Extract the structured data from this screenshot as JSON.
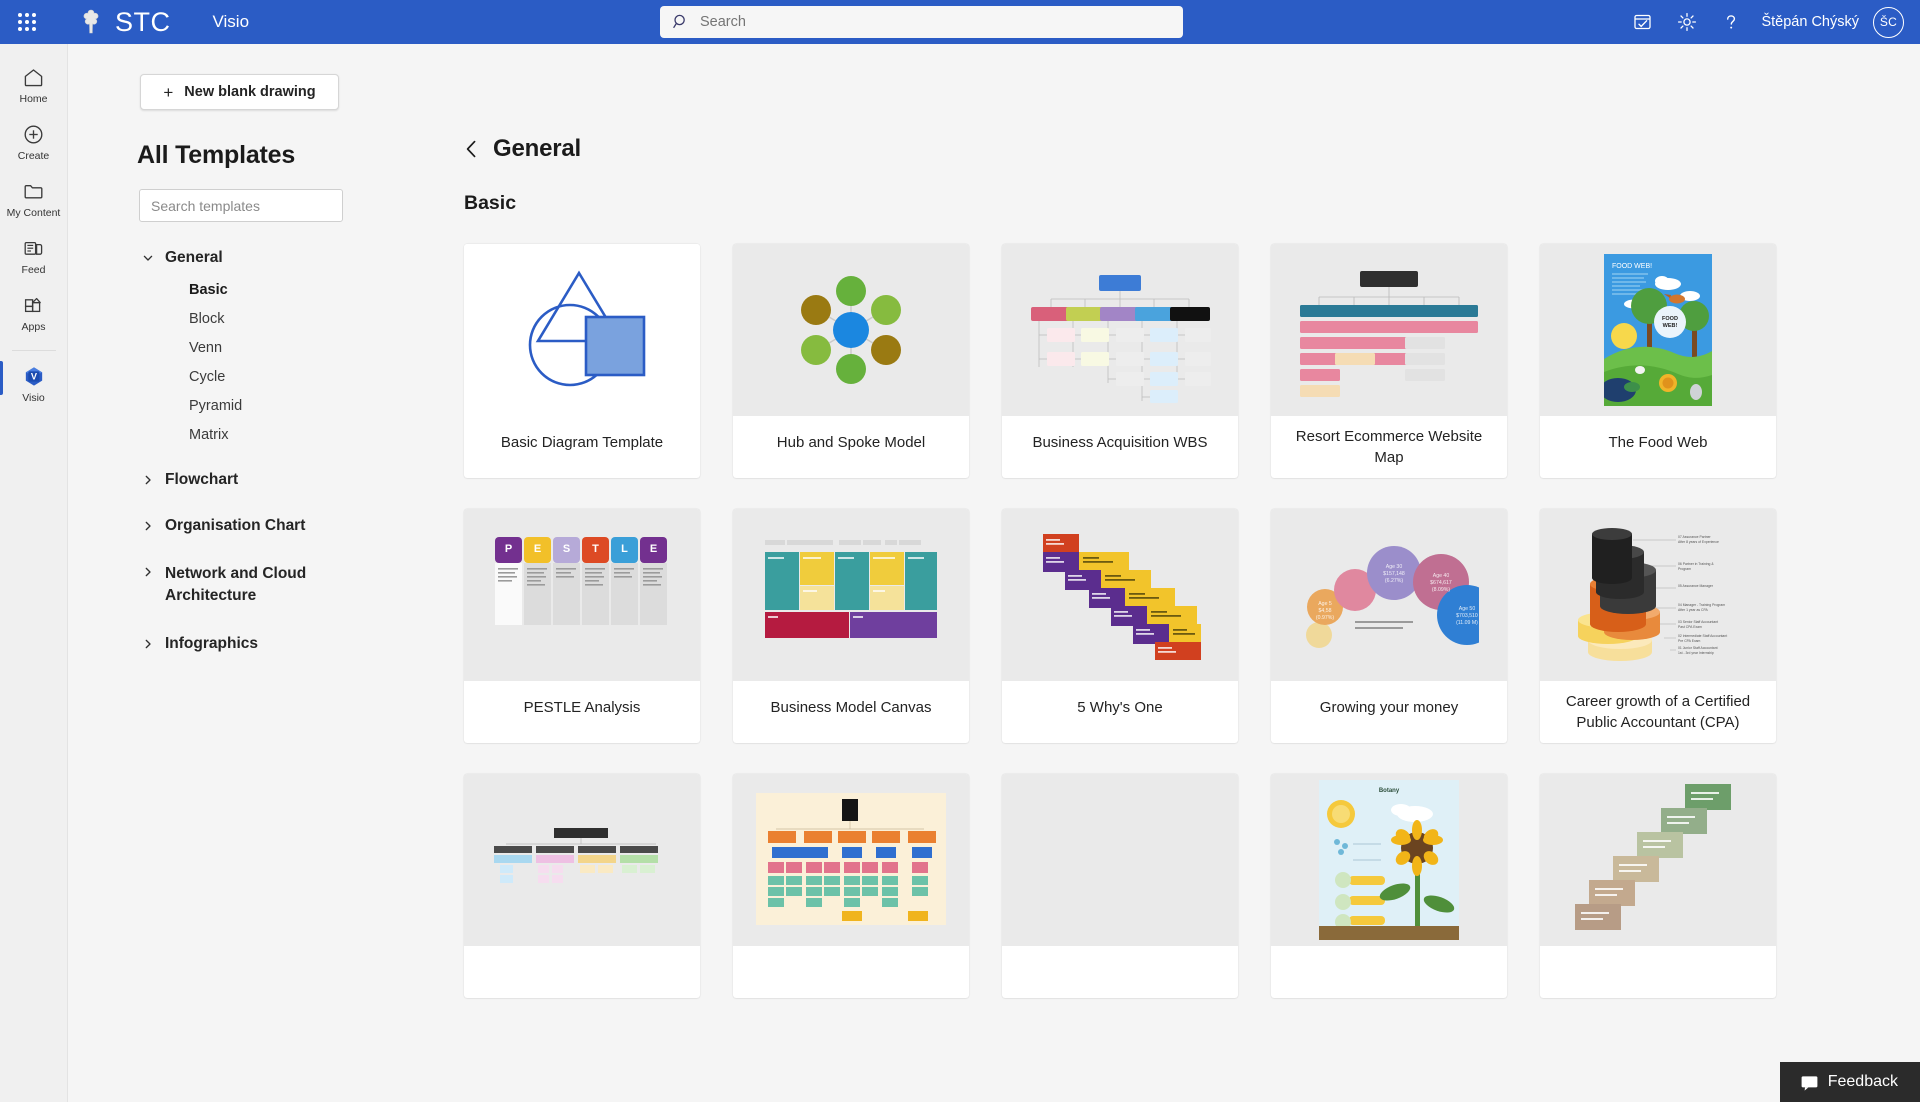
{
  "topbar": {
    "waffle_label": "app-launcher",
    "brand": "STC",
    "app_name": "Visio",
    "search_placeholder": "Search",
    "search_value": "",
    "icons": [
      "tasks-icon",
      "gear-icon",
      "help-icon"
    ],
    "user_name": "Štěpán Chýský",
    "avatar_initials": "ŠC",
    "bg_color": "#2b5cc5"
  },
  "rail": {
    "items": [
      {
        "label": "Home",
        "icon": "home-icon",
        "active": false
      },
      {
        "label": "Create",
        "icon": "plus-circle-icon",
        "active": false
      },
      {
        "label": "My Content",
        "icon": "folder-icon",
        "active": false
      },
      {
        "label": "Feed",
        "icon": "feed-icon",
        "active": false
      },
      {
        "label": "Apps",
        "icon": "apps-icon",
        "active": false
      },
      {
        "label": "Visio",
        "icon": "visio-icon",
        "active": true
      }
    ]
  },
  "leftpanel": {
    "new_blank_drawing": "New blank drawing",
    "heading": "All Templates",
    "search_placeholder": "Search templates",
    "search_value": "",
    "tree": [
      {
        "label": "General",
        "expanded": true,
        "children": [
          "Basic",
          "Block",
          "Venn",
          "Cycle",
          "Pyramid",
          "Matrix"
        ],
        "selected_child": "Basic"
      },
      {
        "label": "Flowchart",
        "expanded": false,
        "children": []
      },
      {
        "label": "Organisation Chart",
        "expanded": false,
        "children": []
      },
      {
        "label": "Network and Cloud Architecture",
        "expanded": false,
        "children": []
      },
      {
        "label": "Infographics",
        "expanded": false,
        "children": []
      }
    ]
  },
  "main": {
    "breadcrumb": "General",
    "section_title": "Basic",
    "cards": [
      {
        "title": "Basic Diagram Template",
        "thumb": "basic-shapes-thumb",
        "white": true
      },
      {
        "title": "Hub and Spoke Model",
        "thumb": "hub-spoke-thumb",
        "white": false
      },
      {
        "title": "Business Acquisition WBS",
        "thumb": "wbs-tree-thumb",
        "white": false
      },
      {
        "title": "Resort Ecommerce Website Map",
        "thumb": "sitemap-thumb",
        "white": false
      },
      {
        "title": "The Food Web",
        "thumb": "food-web-poster-thumb",
        "white": false
      },
      {
        "title": "PESTLE Analysis",
        "thumb": "pestle-columns-thumb",
        "white": false
      },
      {
        "title": "Business Model Canvas",
        "thumb": "bmc-grid-thumb",
        "white": false
      },
      {
        "title": "5 Why's One",
        "thumb": "five-whys-stairs-thumb",
        "white": false
      },
      {
        "title": "Growing your money",
        "thumb": "money-bubbles-thumb",
        "white": false
      },
      {
        "title": "Career growth of a Certified Public Accountant (CPA)",
        "thumb": "cylinders-thumb",
        "white": false
      },
      {
        "title": "",
        "thumb": "org-chart-small-thumb",
        "white": false
      },
      {
        "title": "",
        "thumb": "big-org-chart-thumb",
        "white": false
      },
      {
        "title": "",
        "thumb": "empty-thumb",
        "white": false
      },
      {
        "title": "",
        "thumb": "botany-poster-thumb",
        "white": false
      },
      {
        "title": "",
        "thumb": "green-stairs-thumb",
        "white": false
      }
    ],
    "pestle_letters": [
      "P",
      "E",
      "S",
      "T",
      "L",
      "E"
    ],
    "food_web_title": "FOOD WEB!",
    "food_web_bubble": "FOOD WEB!",
    "botany_title": "Botany"
  },
  "feedback": {
    "label": "Feedback",
    "icon": "feedback-icon"
  },
  "colors": {
    "accent": "#2b5cc5",
    "page_bg": "#f5f5f5",
    "thumb_bg": "#eaeaea",
    "card_bg": "#ffffff"
  }
}
